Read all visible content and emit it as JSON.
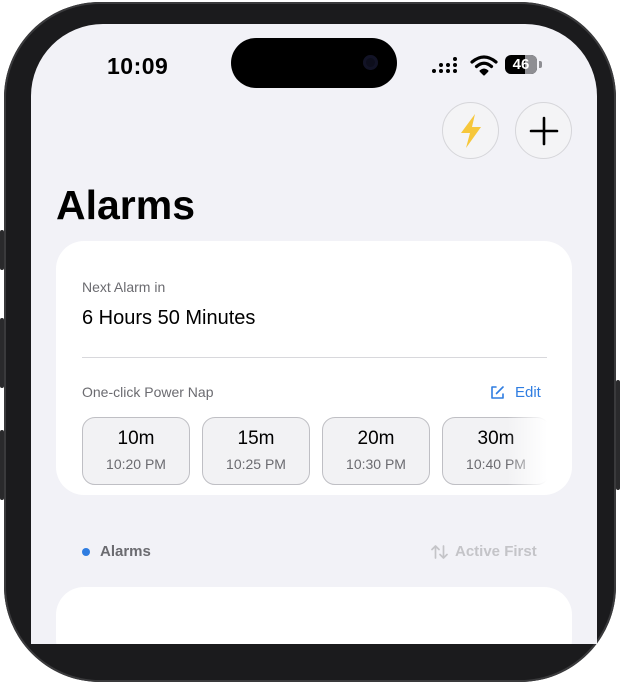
{
  "status_bar": {
    "time": "10:09",
    "battery": "46"
  },
  "header": {
    "title": "Alarms",
    "quick_icon": "lightning-bolt-icon",
    "add_icon": "plus-icon"
  },
  "next_alarm": {
    "label": "Next Alarm in",
    "value": "6 Hours 50 Minutes"
  },
  "power_nap": {
    "label": "One-click Power Nap",
    "edit_label": "Edit",
    "options": [
      {
        "duration": "10m",
        "time": "10:20 PM"
      },
      {
        "duration": "15m",
        "time": "10:25 PM"
      },
      {
        "duration": "20m",
        "time": "10:30 PM"
      },
      {
        "duration": "30m",
        "time": "10:40 PM"
      }
    ]
  },
  "alarms_section": {
    "label": "Alarms",
    "sort_label": "Active First"
  },
  "colors": {
    "accent": "#2f7de1",
    "bolt": "#f6c73b",
    "background": "#f2f2f7"
  }
}
